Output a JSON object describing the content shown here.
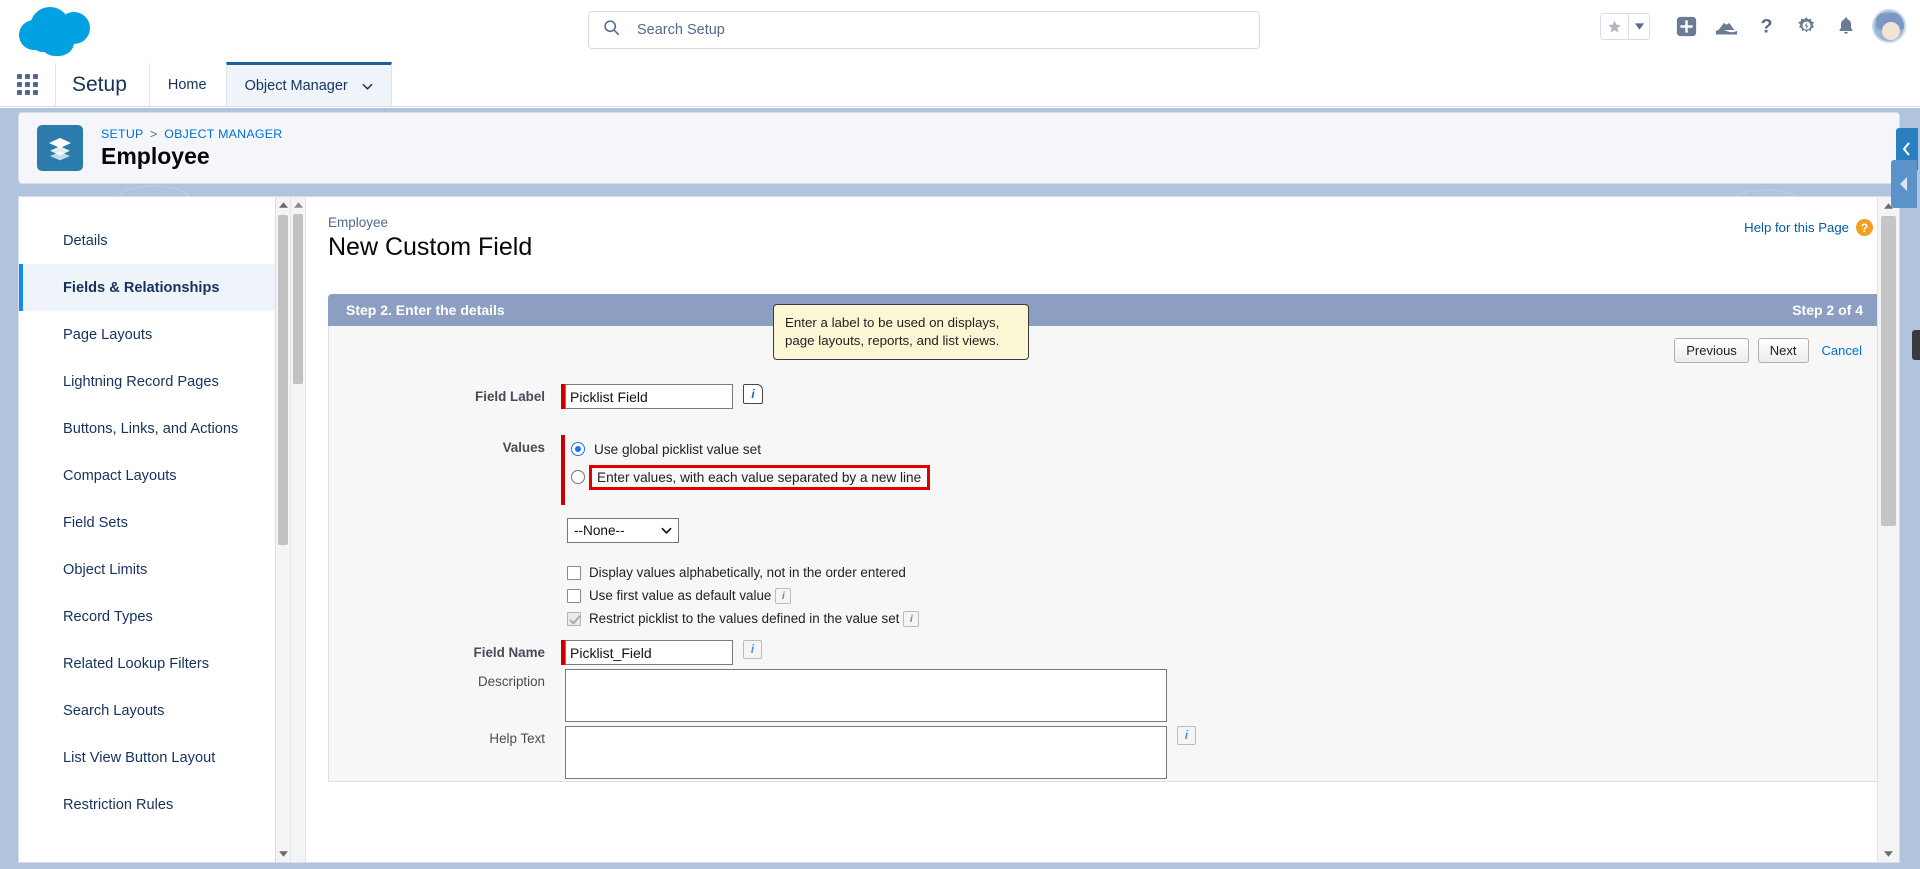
{
  "header": {
    "logo_name": "salesforce-cloud-logo",
    "search": {
      "placeholder": "Search Setup",
      "value": ""
    },
    "actions": [
      {
        "name": "favorites-star",
        "icon": "star-icon"
      },
      {
        "name": "favorites-dropdown",
        "icon": "caret-down-icon"
      },
      {
        "name": "add-button",
        "icon": "plus-square-icon"
      },
      {
        "name": "learning-button",
        "icon": "mountain-icon"
      },
      {
        "name": "help-button",
        "icon": "question-mark-icon"
      },
      {
        "name": "setup-gear",
        "icon": "gear-bolt-icon"
      },
      {
        "name": "notifications",
        "icon": "bell-icon"
      },
      {
        "name": "user-avatar",
        "icon": "avatar-icon"
      }
    ]
  },
  "setup_nav": {
    "app_launcher": "app-launcher-waffle",
    "title": "Setup",
    "tabs": [
      {
        "label": "Home",
        "active": false
      },
      {
        "label": "Object Manager",
        "active": true,
        "has_caret": true
      }
    ]
  },
  "object_header": {
    "icon": "stack-layers-icon",
    "breadcrumb": {
      "root": "SETUP",
      "separator": ">",
      "parent": "OBJECT MANAGER"
    },
    "title": "Employee"
  },
  "sidebar": {
    "items": [
      {
        "label": "Details",
        "active": false
      },
      {
        "label": "Fields & Relationships",
        "active": true
      },
      {
        "label": "Page Layouts",
        "active": false
      },
      {
        "label": "Lightning Record Pages",
        "active": false
      },
      {
        "label": "Buttons, Links, and Actions",
        "active": false
      },
      {
        "label": "Compact Layouts",
        "active": false
      },
      {
        "label": "Field Sets",
        "active": false
      },
      {
        "label": "Object Limits",
        "active": false
      },
      {
        "label": "Record Types",
        "active": false
      },
      {
        "label": "Related Lookup Filters",
        "active": false
      },
      {
        "label": "Search Layouts",
        "active": false
      },
      {
        "label": "List View Button Layout",
        "active": false
      },
      {
        "label": "Restriction Rules",
        "active": false
      }
    ]
  },
  "main": {
    "eyebrow": "Employee",
    "page_title": "New Custom Field",
    "help_link": "Help for this Page",
    "step": {
      "title": "Step 2. Enter the details",
      "counter": "Step 2 of 4"
    },
    "buttons": {
      "previous": "Previous",
      "next": "Next",
      "cancel": "Cancel"
    },
    "tooltip": "Enter a label to be used on displays, page layouts, reports, and list views.",
    "fields": {
      "field_label": {
        "label": "Field Label",
        "value": "Picklist Field",
        "required": true
      },
      "values": {
        "label": "Values",
        "option_global": "Use global picklist value set",
        "option_enter": "Enter values, with each value separated by a new line",
        "selected": "global",
        "highlighted_option": "enter",
        "global_select_value": "--None--"
      },
      "checkboxes": [
        {
          "label": "Display values alphabetically, not in the order entered",
          "checked": false,
          "disabled": false,
          "info": false
        },
        {
          "label": "Use first value as default value",
          "checked": false,
          "disabled": false,
          "info": true
        },
        {
          "label": "Restrict picklist to the values defined in the value set",
          "checked": true,
          "disabled": true,
          "info": true
        }
      ],
      "field_name": {
        "label": "Field Name",
        "value": "Picklist_Field",
        "required": true
      },
      "description": {
        "label": "Description",
        "value": ""
      },
      "help_text": {
        "label": "Help Text",
        "value": ""
      }
    }
  },
  "colors": {
    "brand_blue": "#00a1e0",
    "link_blue": "#0070d2",
    "step_banner": "#8c9ec1",
    "highlight_red": "#e00000",
    "required_red": "#cc0000",
    "tooltip_bg": "#fbf6d4",
    "backdrop": "#b0c4de"
  }
}
